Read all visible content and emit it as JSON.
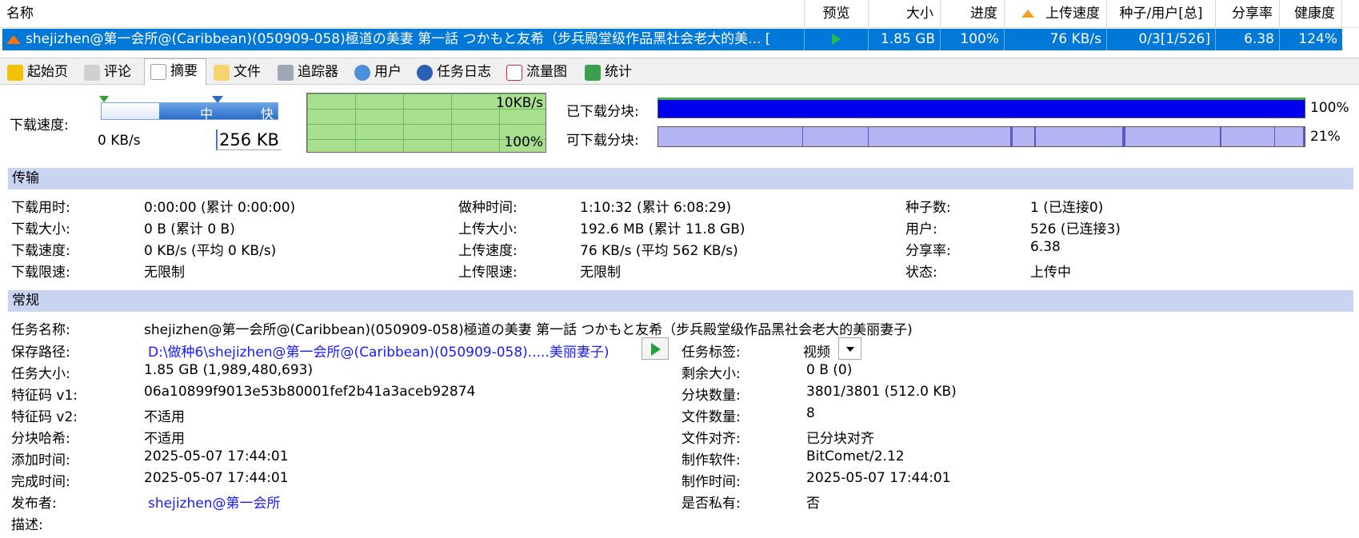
{
  "list_header": {
    "name": "名称",
    "preview": "预览",
    "size": "大小",
    "progress": "进度",
    "upload_speed": "上传速度",
    "seeds_peers": "种子/用户[总]",
    "ratio": "分享率",
    "health": "健康度"
  },
  "task_row": {
    "name": "shejizhen@第一会所@(Caribbean)(050909-058)極道の美妻 第一話 つかもと友希（步兵殿堂级作品黑社会老大的美... [",
    "size": "1.85 GB",
    "progress": "100%",
    "upload_speed": "76 KB/s",
    "seeds_peers": "0/3[1/526]",
    "ratio": "6.38",
    "health": "124%"
  },
  "tabs": [
    {
      "label": "起始页",
      "icon": "home-icon"
    },
    {
      "label": "评论",
      "icon": "comment-icon"
    },
    {
      "label": "摘要",
      "icon": "summary-icon"
    },
    {
      "label": "文件",
      "icon": "file-icon"
    },
    {
      "label": "追踪器",
      "icon": "tracker-icon"
    },
    {
      "label": "用户",
      "icon": "users-icon"
    },
    {
      "label": "任务日志",
      "icon": "info-icon"
    },
    {
      "label": "流量图",
      "icon": "chart-icon"
    },
    {
      "label": "统计",
      "icon": "stats-icon"
    }
  ],
  "speed": {
    "label": "下载速度:",
    "current": "0 KB/s",
    "limit_value": "256 KB",
    "slider_mid": "中",
    "slider_fast": "快",
    "graph_max": "10KB/s",
    "graph_pct": "100%"
  },
  "pieces": {
    "downloaded_label": "已下载分块:",
    "downloaded_pct": "100%",
    "downloaded_fraction": 1.0,
    "available_label": "可下载分块:",
    "available_pct": "21%",
    "available_fraction": 0.21
  },
  "transfer": {
    "title": "传输",
    "col1": [
      [
        "下载用时:",
        "0:00:00 (累计 0:00:00)"
      ],
      [
        "下载大小:",
        "0 B (累计 0 B)"
      ],
      [
        "下载速度:",
        "0 KB/s (平均 0 KB/s)"
      ],
      [
        "下载限速:",
        "无限制"
      ]
    ],
    "col2": [
      [
        "做种时间:",
        "1:10:32 (累计 6:08:29)"
      ],
      [
        "上传大小:",
        "192.6 MB (累计 11.8 GB)"
      ],
      [
        "上传速度:",
        "76 KB/s (平均 562 KB/s)"
      ],
      [
        "上传限速:",
        "无限制"
      ]
    ],
    "col3": [
      [
        "种子数:",
        "1 (已连接0)"
      ],
      [
        "用户:",
        "526 (已连接3)"
      ],
      [
        "分享率:",
        "6.38"
      ],
      [
        "状态:",
        "上传中"
      ]
    ]
  },
  "general": {
    "title": "常规",
    "task_name_label": "任务名称:",
    "task_name": "shejizhen@第一会所@(Caribbean)(050909-058)極道の美妻 第一話 つかもと友希（步兵殿堂级作品黑社会老大的美丽妻子)",
    "save_path_label": "保存路径:",
    "save_path": "D:\\做种6\\shejizhen@第一会所@(Caribbean)(050909-058).....美丽妻子)",
    "task_tag_label": "任务标签:",
    "task_tag": "视频",
    "left": [
      [
        "任务大小:",
        "1.85 GB (1,989,480,693)"
      ],
      [
        "特征码 v1:",
        "06a10899f9013e53b80001fef2b41a3aceb92874"
      ],
      [
        "特征码 v2:",
        "不适用"
      ],
      [
        "分块哈希:",
        "不适用"
      ],
      [
        "添加时间:",
        "2025-05-07 17:44:01"
      ],
      [
        "完成时间:",
        "2025-05-07 17:44:01"
      ]
    ],
    "right": [
      [
        "剩余大小:",
        "0 B (0)"
      ],
      [
        "分块数量:",
        "3801/3801 (512.0 KB)"
      ],
      [
        "文件数量:",
        "8"
      ],
      [
        "文件对齐:",
        "已分块对齐"
      ],
      [
        "制作软件:",
        "BitComet/2.12"
      ],
      [
        "制作时间:",
        "2025-05-07 17:44:01"
      ],
      [
        "是否私有:",
        "否"
      ]
    ],
    "publisher_label": "发布者:",
    "publisher": "shejizhen@第一会所",
    "description_label": "描述:"
  },
  "colors": {
    "selection": "#0078d7",
    "section": "#c8d4f0",
    "blue_bar": "#0000ee",
    "avail_bar": "#b4b4f4",
    "graph": "#a8e090",
    "link": "#1a1aff"
  }
}
